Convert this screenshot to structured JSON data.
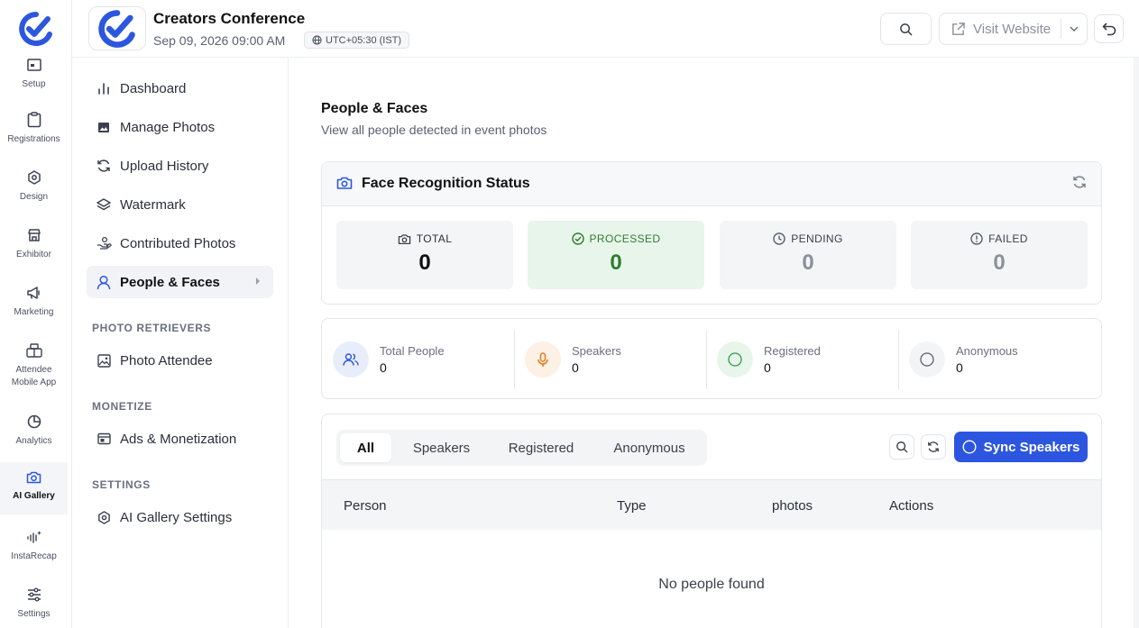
{
  "colors": {
    "accent": "#2d56e0",
    "success": "#2e7d32",
    "success_bg": "#e8f5ea"
  },
  "rail": {
    "items": [
      {
        "label": "Setup",
        "icon": "setup-icon"
      },
      {
        "label": "Registrations",
        "icon": "clipboard-icon"
      },
      {
        "label": "Design",
        "icon": "design-icon"
      },
      {
        "label": "Exhibitor",
        "icon": "store-icon"
      },
      {
        "label": "Marketing",
        "icon": "megaphone-icon"
      },
      {
        "label": "Attendee Mobile App",
        "icon": "mobile-app-icon"
      },
      {
        "label": "Analytics",
        "icon": "pie-chart-icon"
      },
      {
        "label": "AI Gallery",
        "icon": "camera-icon",
        "active": true
      },
      {
        "label": "InstaRecap",
        "icon": "sparkle-wave-icon"
      },
      {
        "label": "Settings",
        "icon": "sliders-icon"
      }
    ]
  },
  "header": {
    "event_title": "Creators Conference",
    "event_date": "Sep 09, 2026 09:00 AM",
    "timezone": "UTC+05:30 (IST)",
    "visit_label": "Visit Website"
  },
  "subnav": {
    "items": [
      {
        "label": "Dashboard",
        "icon": "bar-chart-icon"
      },
      {
        "label": "Manage Photos",
        "icon": "image-icon"
      },
      {
        "label": "Upload History",
        "icon": "refresh-icon"
      },
      {
        "label": "Watermark",
        "icon": "layers-icon"
      },
      {
        "label": "Contributed Photos",
        "icon": "hand-icon"
      },
      {
        "label": "People & Faces",
        "icon": "person-icon",
        "active": true
      }
    ],
    "sections": [
      {
        "title": "PHOTO RETRIEVERS",
        "items": [
          {
            "label": "Photo Attendee",
            "icon": "photo-icon"
          }
        ]
      },
      {
        "title": "MONETIZE",
        "items": [
          {
            "label": "Ads & Monetization",
            "icon": "ad-icon"
          }
        ]
      },
      {
        "title": "SETTINGS",
        "items": [
          {
            "label": "AI Gallery Settings",
            "icon": "gear-icon"
          }
        ]
      }
    ]
  },
  "main": {
    "title": "People & Faces",
    "subtitle": "View all people detected in event photos",
    "face_status": {
      "title": "Face Recognition Status",
      "stats": [
        {
          "label": "TOTAL",
          "value": "0"
        },
        {
          "label": "PROCESSED",
          "value": "0"
        },
        {
          "label": "PENDING",
          "value": "0"
        },
        {
          "label": "FAILED",
          "value": "0"
        }
      ]
    },
    "people_counts": [
      {
        "label": "Total People",
        "value": "0"
      },
      {
        "label": "Speakers",
        "value": "0"
      },
      {
        "label": "Registered",
        "value": "0"
      },
      {
        "label": "Anonymous",
        "value": "0"
      }
    ],
    "tabs": [
      "All",
      "Speakers",
      "Registered",
      "Anonymous"
    ],
    "sync_label": "Sync Speakers",
    "columns": [
      "Person",
      "Type",
      "photos",
      "Actions"
    ],
    "empty_text": "No people found"
  }
}
